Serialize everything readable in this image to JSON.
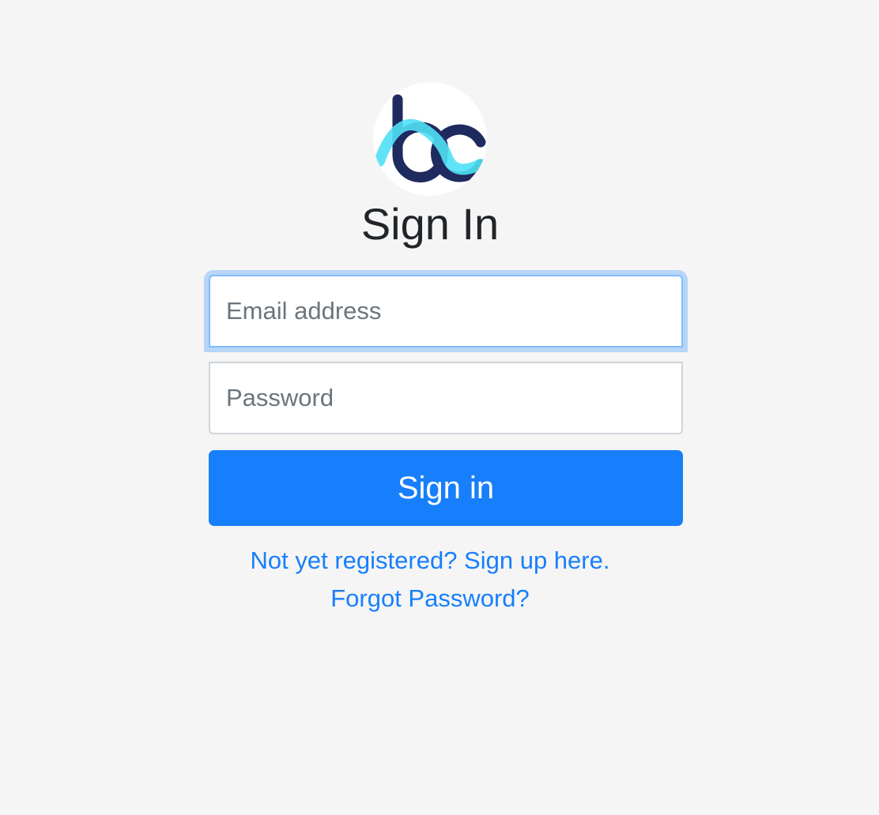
{
  "brand": {
    "logo_icon": "bc-logo-icon",
    "colors": {
      "logo_navy": "#1f2a5e",
      "logo_cyan": "#4fe0f5",
      "primary": "#177ffb",
      "background": "#f5f5f5"
    }
  },
  "form": {
    "title": "Sign In",
    "email_placeholder": "Email address",
    "password_placeholder": "Password",
    "submit_label": "Sign in"
  },
  "links": {
    "signup": "Not yet registered? Sign up here.",
    "forgot_password": "Forgot Password?"
  }
}
